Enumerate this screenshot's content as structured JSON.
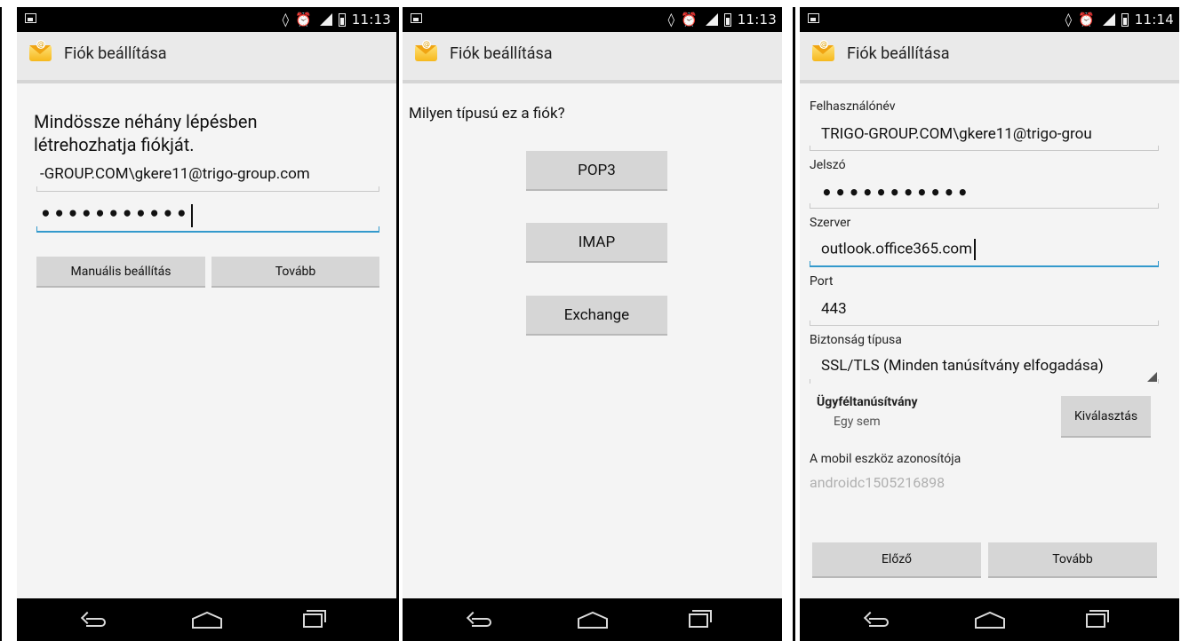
{
  "status_bar": {
    "screen1_time": "11:13",
    "screen2_time": "11:13",
    "screen3_time": "11:14",
    "icons": [
      "screenshot-icon",
      "vibrate-icon",
      "alarm-icon",
      "hspa-signal-icon",
      "battery-icon"
    ]
  },
  "app": {
    "title": "Fiók beállítása",
    "icon": "email-envelope-icon"
  },
  "screen1": {
    "heading": "Mindössze néhány lépésben létrehozhatja fiókját.",
    "email_value": "-GROUP.COM\\gkere11@trigo-group.com",
    "password_value": "•••••••••••",
    "manual_button": "Manuális beállítás",
    "next_button": "Tovább"
  },
  "screen2": {
    "question": "Milyen típusú ez a fiók?",
    "pop3_button": "POP3",
    "imap_button": "IMAP",
    "exchange_button": "Exchange"
  },
  "screen3": {
    "username_label": "Felhasználónév",
    "username_value": "TRIGO-GROUP.COM\\gkere11@trigo-grou",
    "password_label": "Jelszó",
    "password_value": "•••••••••••",
    "server_label": "Szerver",
    "server_value": "outlook.office365.com",
    "port_label": "Port",
    "port_value": "443",
    "security_label": "Biztonság típusa",
    "security_value": "SSL/TLS (Minden tanúsítvány elfogadása)",
    "client_cert_label": "Ügyféltanúsítvány",
    "client_cert_value": "Egy sem",
    "choose_button": "Kiválasztás",
    "device_id_label": "A mobil eszköz azonosítója",
    "device_id_value": "androidc1505216898",
    "prev_button": "Előző",
    "next_button": "Tovább"
  },
  "colors": {
    "focus_underline": "#3399cc",
    "button_bg": "#d6d6d6",
    "background": "#f4f4f4",
    "action_bar": "#eaeaea",
    "device_id_text": "#b0b0b0"
  }
}
